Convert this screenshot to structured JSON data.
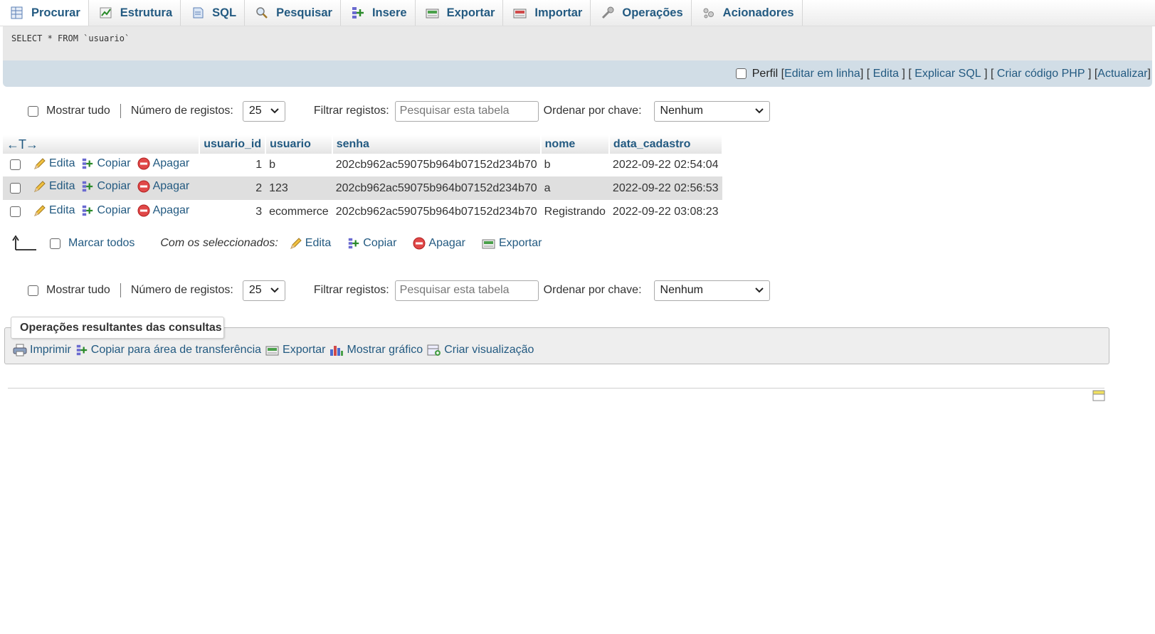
{
  "tabs": [
    {
      "label": "Procurar",
      "icon": "browse-icon",
      "active": true
    },
    {
      "label": "Estrutura",
      "icon": "structure-icon"
    },
    {
      "label": "SQL",
      "icon": "sql-icon"
    },
    {
      "label": "Pesquisar",
      "icon": "search-icon"
    },
    {
      "label": "Insere",
      "icon": "insert-icon"
    },
    {
      "label": "Exportar",
      "icon": "export-icon"
    },
    {
      "label": "Importar",
      "icon": "import-icon"
    },
    {
      "label": "Operações",
      "icon": "wrench-icon"
    },
    {
      "label": "Acionadores",
      "icon": "triggers-icon"
    }
  ],
  "query": {
    "sql": "SELECT * FROM `usuario`",
    "profile_label": "Perfil",
    "links": [
      "Editar em linha",
      "Edita",
      "Explicar SQL",
      "Criar código PHP",
      "Actualizar"
    ]
  },
  "navigation": {
    "show_all": "Mostrar tudo",
    "num_records_label": "Número de registos:",
    "num_records_value": "25",
    "filter_label": "Filtrar registos:",
    "filter_placeholder": "Pesquisar esta tabela",
    "sort_label": "Ordenar por chave:",
    "sort_value": "Nenhum"
  },
  "table": {
    "arrows": "←T→",
    "columns": [
      "usuario_id",
      "usuario",
      "senha",
      "nome",
      "data_cadastro"
    ],
    "action_labels": {
      "edit": "Edita",
      "copy": "Copiar",
      "delete": "Apagar"
    },
    "rows": [
      {
        "usuario_id": "1",
        "usuario": "b",
        "senha": "202cb962ac59075b964b07152d234b70",
        "nome": "b",
        "data_cadastro": "2022-09-22 02:54:04"
      },
      {
        "usuario_id": "2",
        "usuario": "123",
        "senha": "202cb962ac59075b964b07152d234b70",
        "nome": "a",
        "data_cadastro": "2022-09-22 02:56:53"
      },
      {
        "usuario_id": "3",
        "usuario": "ecommerce",
        "senha": "202cb962ac59075b964b07152d234b70",
        "nome": "Registrando",
        "data_cadastro": "2022-09-22 03:08:23"
      }
    ]
  },
  "bulk": {
    "check_all": "Marcar todos",
    "with_selected": "Com os seleccionados:",
    "edit": "Edita",
    "copy": "Copiar",
    "delete": "Apagar",
    "export": "Exportar"
  },
  "operations": {
    "title": "Operações resultantes das consultas",
    "print": "Imprimir",
    "copy_clipboard": "Copiar para área de transferência",
    "export": "Exportar",
    "chart": "Mostrar gráfico",
    "view": "Criar visualização"
  }
}
